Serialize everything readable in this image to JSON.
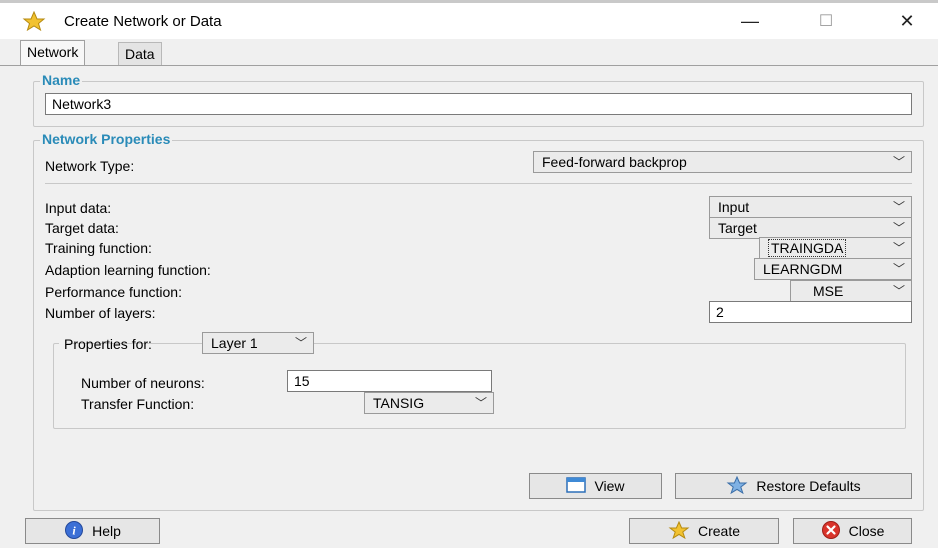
{
  "window": {
    "title": "Create Network or Data",
    "minimize": "—",
    "maximize": "☐",
    "close": "✕"
  },
  "tabs": [
    {
      "label": "Network"
    },
    {
      "label": "Data"
    }
  ],
  "name_group": {
    "legend": "Name",
    "value": "Network3"
  },
  "props_group": {
    "legend": "Network Properties",
    "network_type_label": "Network Type:",
    "network_type_value": "Feed-forward backprop",
    "input_label": "Input data:",
    "input_value": "Input",
    "target_label": "Target data:",
    "target_value": "Target",
    "training_label": "Training function:",
    "training_value": "TRAINGDA",
    "adaption_label": "Adaption learning function:",
    "adaption_value": "LEARNGDM",
    "performance_label": "Performance function:",
    "performance_value": "MSE",
    "layers_label": "Number of layers:",
    "layers_value": "2"
  },
  "layer_group": {
    "properties_for_label": "Properties for:",
    "layer_value": "Layer 1",
    "neurons_label": "Number of neurons:",
    "neurons_value": "15",
    "transfer_label": "Transfer Function:",
    "transfer_value": "TANSIG"
  },
  "buttons": {
    "view": "View",
    "restore": "Restore Defaults",
    "help": "Help",
    "create": "Create",
    "close": "Close"
  },
  "colors": {
    "legend": "#2a8bb8",
    "close_icon": "#d9342b",
    "help_icon": "#3b6fd6",
    "star": "#f2c230"
  }
}
